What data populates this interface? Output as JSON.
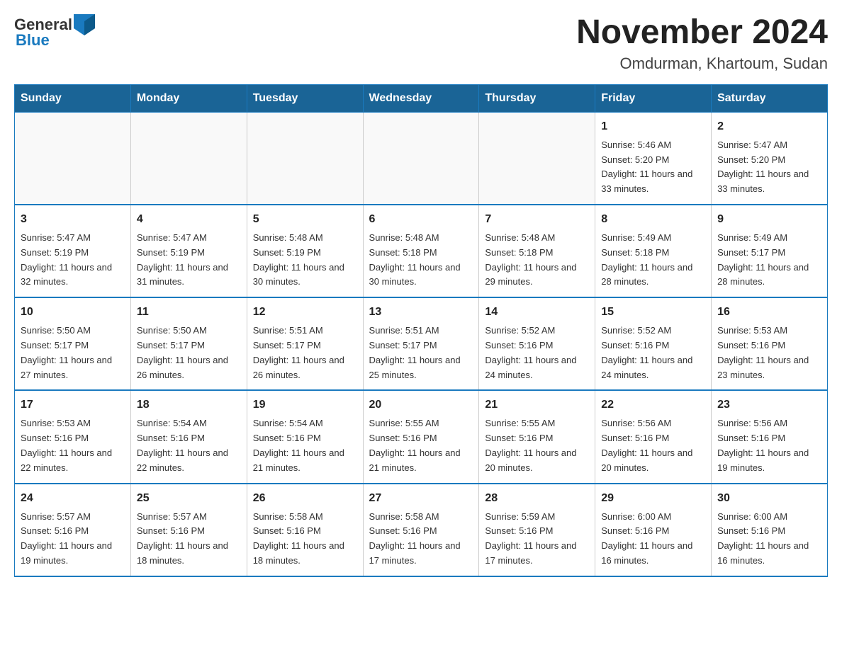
{
  "header": {
    "logo_general": "General",
    "logo_blue": "Blue",
    "month_year": "November 2024",
    "location": "Omdurman, Khartoum, Sudan"
  },
  "weekdays": [
    "Sunday",
    "Monday",
    "Tuesday",
    "Wednesday",
    "Thursday",
    "Friday",
    "Saturday"
  ],
  "weeks": [
    [
      {
        "day": "",
        "info": ""
      },
      {
        "day": "",
        "info": ""
      },
      {
        "day": "",
        "info": ""
      },
      {
        "day": "",
        "info": ""
      },
      {
        "day": "",
        "info": ""
      },
      {
        "day": "1",
        "info": "Sunrise: 5:46 AM\nSunset: 5:20 PM\nDaylight: 11 hours and 33 minutes."
      },
      {
        "day": "2",
        "info": "Sunrise: 5:47 AM\nSunset: 5:20 PM\nDaylight: 11 hours and 33 minutes."
      }
    ],
    [
      {
        "day": "3",
        "info": "Sunrise: 5:47 AM\nSunset: 5:19 PM\nDaylight: 11 hours and 32 minutes."
      },
      {
        "day": "4",
        "info": "Sunrise: 5:47 AM\nSunset: 5:19 PM\nDaylight: 11 hours and 31 minutes."
      },
      {
        "day": "5",
        "info": "Sunrise: 5:48 AM\nSunset: 5:19 PM\nDaylight: 11 hours and 30 minutes."
      },
      {
        "day": "6",
        "info": "Sunrise: 5:48 AM\nSunset: 5:18 PM\nDaylight: 11 hours and 30 minutes."
      },
      {
        "day": "7",
        "info": "Sunrise: 5:48 AM\nSunset: 5:18 PM\nDaylight: 11 hours and 29 minutes."
      },
      {
        "day": "8",
        "info": "Sunrise: 5:49 AM\nSunset: 5:18 PM\nDaylight: 11 hours and 28 minutes."
      },
      {
        "day": "9",
        "info": "Sunrise: 5:49 AM\nSunset: 5:17 PM\nDaylight: 11 hours and 28 minutes."
      }
    ],
    [
      {
        "day": "10",
        "info": "Sunrise: 5:50 AM\nSunset: 5:17 PM\nDaylight: 11 hours and 27 minutes."
      },
      {
        "day": "11",
        "info": "Sunrise: 5:50 AM\nSunset: 5:17 PM\nDaylight: 11 hours and 26 minutes."
      },
      {
        "day": "12",
        "info": "Sunrise: 5:51 AM\nSunset: 5:17 PM\nDaylight: 11 hours and 26 minutes."
      },
      {
        "day": "13",
        "info": "Sunrise: 5:51 AM\nSunset: 5:17 PM\nDaylight: 11 hours and 25 minutes."
      },
      {
        "day": "14",
        "info": "Sunrise: 5:52 AM\nSunset: 5:16 PM\nDaylight: 11 hours and 24 minutes."
      },
      {
        "day": "15",
        "info": "Sunrise: 5:52 AM\nSunset: 5:16 PM\nDaylight: 11 hours and 24 minutes."
      },
      {
        "day": "16",
        "info": "Sunrise: 5:53 AM\nSunset: 5:16 PM\nDaylight: 11 hours and 23 minutes."
      }
    ],
    [
      {
        "day": "17",
        "info": "Sunrise: 5:53 AM\nSunset: 5:16 PM\nDaylight: 11 hours and 22 minutes."
      },
      {
        "day": "18",
        "info": "Sunrise: 5:54 AM\nSunset: 5:16 PM\nDaylight: 11 hours and 22 minutes."
      },
      {
        "day": "19",
        "info": "Sunrise: 5:54 AM\nSunset: 5:16 PM\nDaylight: 11 hours and 21 minutes."
      },
      {
        "day": "20",
        "info": "Sunrise: 5:55 AM\nSunset: 5:16 PM\nDaylight: 11 hours and 21 minutes."
      },
      {
        "day": "21",
        "info": "Sunrise: 5:55 AM\nSunset: 5:16 PM\nDaylight: 11 hours and 20 minutes."
      },
      {
        "day": "22",
        "info": "Sunrise: 5:56 AM\nSunset: 5:16 PM\nDaylight: 11 hours and 20 minutes."
      },
      {
        "day": "23",
        "info": "Sunrise: 5:56 AM\nSunset: 5:16 PM\nDaylight: 11 hours and 19 minutes."
      }
    ],
    [
      {
        "day": "24",
        "info": "Sunrise: 5:57 AM\nSunset: 5:16 PM\nDaylight: 11 hours and 19 minutes."
      },
      {
        "day": "25",
        "info": "Sunrise: 5:57 AM\nSunset: 5:16 PM\nDaylight: 11 hours and 18 minutes."
      },
      {
        "day": "26",
        "info": "Sunrise: 5:58 AM\nSunset: 5:16 PM\nDaylight: 11 hours and 18 minutes."
      },
      {
        "day": "27",
        "info": "Sunrise: 5:58 AM\nSunset: 5:16 PM\nDaylight: 11 hours and 17 minutes."
      },
      {
        "day": "28",
        "info": "Sunrise: 5:59 AM\nSunset: 5:16 PM\nDaylight: 11 hours and 17 minutes."
      },
      {
        "day": "29",
        "info": "Sunrise: 6:00 AM\nSunset: 5:16 PM\nDaylight: 11 hours and 16 minutes."
      },
      {
        "day": "30",
        "info": "Sunrise: 6:00 AM\nSunset: 5:16 PM\nDaylight: 11 hours and 16 minutes."
      }
    ]
  ]
}
